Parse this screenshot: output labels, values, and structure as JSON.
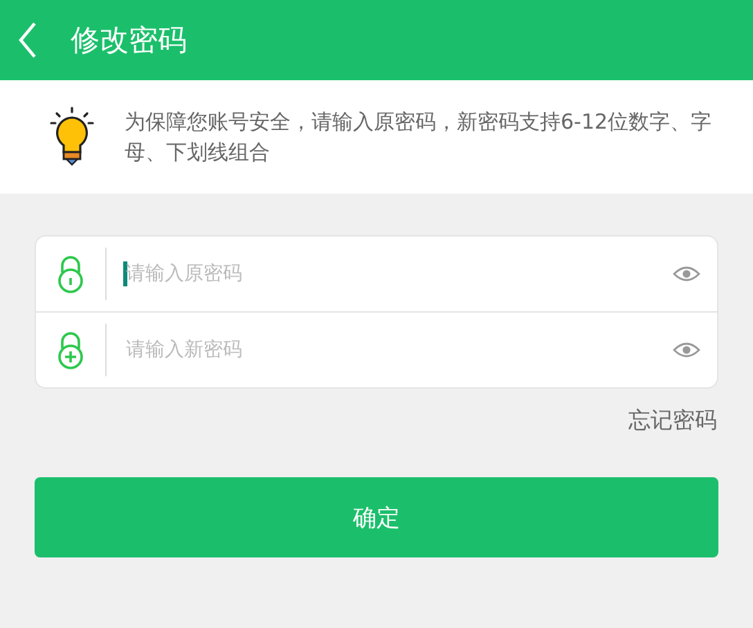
{
  "header": {
    "title": "修改密码"
  },
  "notice": {
    "text": "为保障您账号安全，请输入原密码，新密码支持6-12位数字、字母、下划线组合"
  },
  "fields": [
    {
      "kind": "lock",
      "placeholder": "请输入原密码",
      "focused": true
    },
    {
      "kind": "lock-plus",
      "placeholder": "请输入新密码",
      "focused": false
    }
  ],
  "forgot_link": "忘记密码",
  "confirm_button": "确定"
}
